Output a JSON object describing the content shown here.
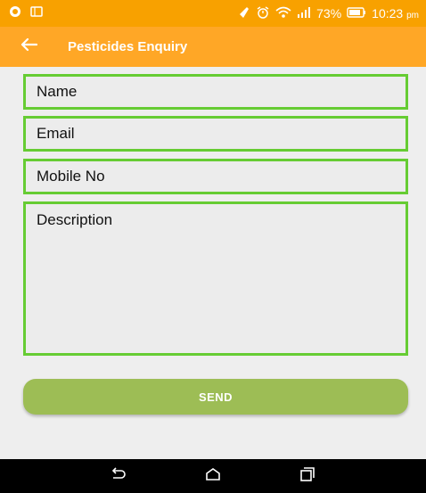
{
  "status_bar": {
    "battery": "73%",
    "time": "10:23",
    "ampm": "pm"
  },
  "app_bar": {
    "title": "Pesticides Enquiry"
  },
  "form": {
    "name_placeholder": "Name",
    "email_placeholder": "Email",
    "mobile_placeholder": "Mobile No",
    "description_placeholder": "Description",
    "send_label": "SEND"
  },
  "colors": {
    "status_bar": "#f8a100",
    "app_bar": "#ffa726",
    "field_border": "#66cc33",
    "send_button": "#9dbd55",
    "nav_bar": "#000000"
  },
  "icons": {
    "status_left": [
      "target-circle-icon",
      "tablet-icon"
    ],
    "status_right": [
      "phone-icon",
      "alarm-icon",
      "wifi-icon",
      "signal-icon",
      "battery-icon"
    ],
    "app_bar": [
      "back-arrow-icon"
    ],
    "nav": [
      "back-nav-icon",
      "home-nav-icon",
      "recents-nav-icon"
    ]
  }
}
